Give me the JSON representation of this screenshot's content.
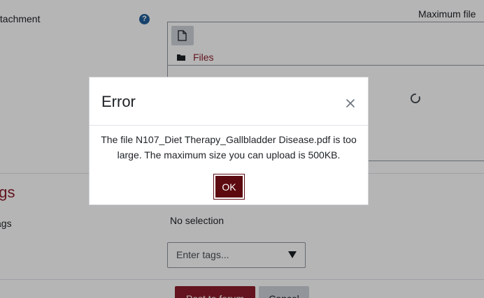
{
  "form": {
    "attachment_label": "ttachment",
    "max_file_label": "Maximum file",
    "filepicker": {
      "folder_label": "Files"
    },
    "tags_heading": "ags",
    "tags_label": "ags",
    "tags_selection": "No selection",
    "tags_placeholder": "Enter tags...",
    "post_button": "Post to forum",
    "cancel_button": "Cancel"
  },
  "modal": {
    "title": "Error",
    "message_line1": "The file N107_Diet Therapy_Gallbladder Disease.pdf is too",
    "message_line2": "large. The maximum size you can upload is 500KB.",
    "ok_button": "OK"
  },
  "colors": {
    "brand": "#8e1d2b",
    "ok_button": "#5c0a10",
    "help_icon": "#1f5f9a"
  },
  "icons": {
    "help": "question-circle-icon",
    "add_file": "file-icon",
    "folder": "folder-icon",
    "loading": "spinner-icon",
    "close": "close-icon",
    "dropdown": "caret-down-icon"
  }
}
